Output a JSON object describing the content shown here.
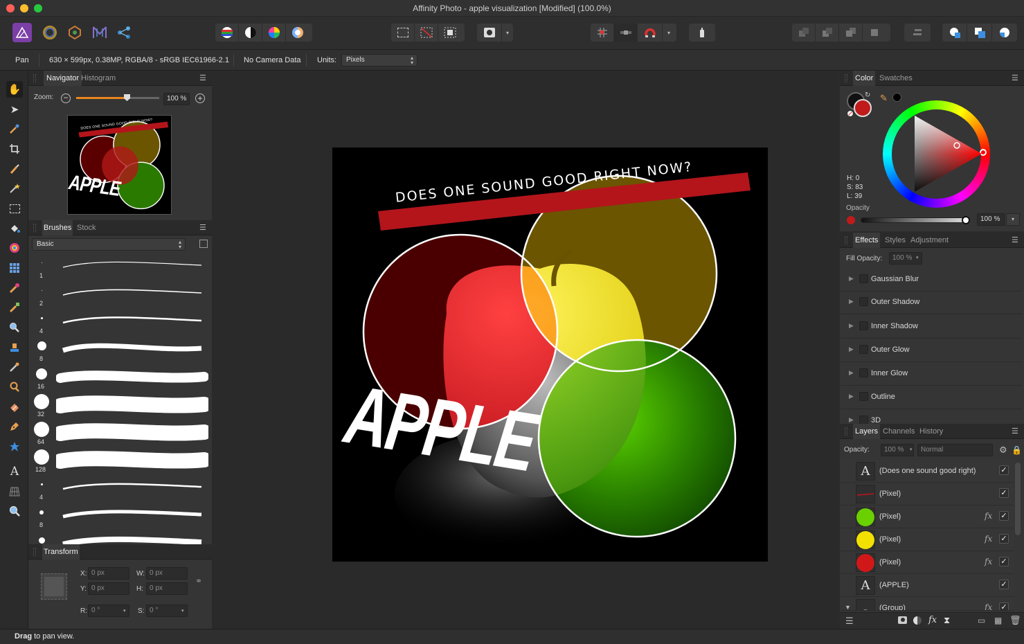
{
  "window": {
    "title": "Affinity Photo - apple visualization [Modified] (100.0%)"
  },
  "context_bar": {
    "tool": "Pan",
    "doc_info": "630 × 599px, 0.38MP, RGBA/8 - sRGB IEC61966-2.1",
    "camera": "No Camera Data",
    "units_label": "Units:",
    "units_value": "Pixels"
  },
  "navigator": {
    "tabs": [
      "Navigator",
      "Histogram"
    ],
    "zoom_label": "Zoom:",
    "zoom_value": "100 %",
    "thumb_banner": "DOES ONE SOUND GOOD RIGHT NOW?",
    "thumb_word": "APPLE"
  },
  "brushes": {
    "tabs": [
      "Brushes",
      "Stock"
    ],
    "category": "Basic",
    "items": [
      {
        "size": "1"
      },
      {
        "size": "2"
      },
      {
        "size": "4"
      },
      {
        "size": "8"
      },
      {
        "size": "16"
      },
      {
        "size": "32"
      },
      {
        "size": "64"
      },
      {
        "size": "128"
      },
      {
        "size": "4"
      },
      {
        "size": "8"
      }
    ]
  },
  "transform": {
    "tab": "Transform",
    "x_label": "X:",
    "x_value": "0 px",
    "y_label": "Y:",
    "y_value": "0 px",
    "w_label": "W:",
    "w_value": "0 px",
    "h_label": "H:",
    "h_value": "0 px",
    "r_label": "R:",
    "r_value": "0 °",
    "s_label": "S:",
    "s_value": "0 °"
  },
  "color_panel": {
    "tabs": [
      "Color",
      "Swatches"
    ],
    "h": "H: 0",
    "s": "S: 83",
    "l": "L: 39",
    "opacity_label": "Opacity",
    "opacity_value": "100 %",
    "fill_color": "#c01a1a"
  },
  "effects_panel": {
    "tabs": [
      "Effects",
      "Styles",
      "Adjustment"
    ],
    "fill_opacity_label": "Fill Opacity:",
    "fill_opacity_value": "100 %",
    "effects": [
      "Gaussian Blur",
      "Outer Shadow",
      "Inner Shadow",
      "Outer Glow",
      "Inner Glow",
      "Outline",
      "3D"
    ]
  },
  "layers_panel": {
    "tabs": [
      "Layers",
      "Channels",
      "History"
    ],
    "opacity_label": "Opacity:",
    "opacity_value": "100 %",
    "blend_mode": "Normal",
    "fx_mark": "fx",
    "check_mark": "✓",
    "layers": [
      {
        "name": "(Does one sound good right)",
        "thumb": "text",
        "fx": false
      },
      {
        "name": "(Pixel)",
        "thumb": "line",
        "fx": false
      },
      {
        "name": "(Pixel)",
        "thumb": "green",
        "fx": true
      },
      {
        "name": "(Pixel)",
        "thumb": "yellow",
        "fx": true
      },
      {
        "name": "(Pixel)",
        "thumb": "red",
        "fx": true
      },
      {
        "name": "(APPLE)",
        "thumb": "text",
        "fx": false
      },
      {
        "name": "(Group)",
        "thumb": "group",
        "fx": true
      }
    ]
  },
  "canvas": {
    "banner_text": "DOES ONE SOUND GOOD RIGHT NOW?",
    "word": "APPLE",
    "colors": {
      "red": "#5a0000",
      "yellow": "#6b5500",
      "green": "#1c6a00",
      "banner": "#b3151b"
    }
  },
  "status": {
    "bold": "Drag",
    "rest": " to pan view."
  }
}
